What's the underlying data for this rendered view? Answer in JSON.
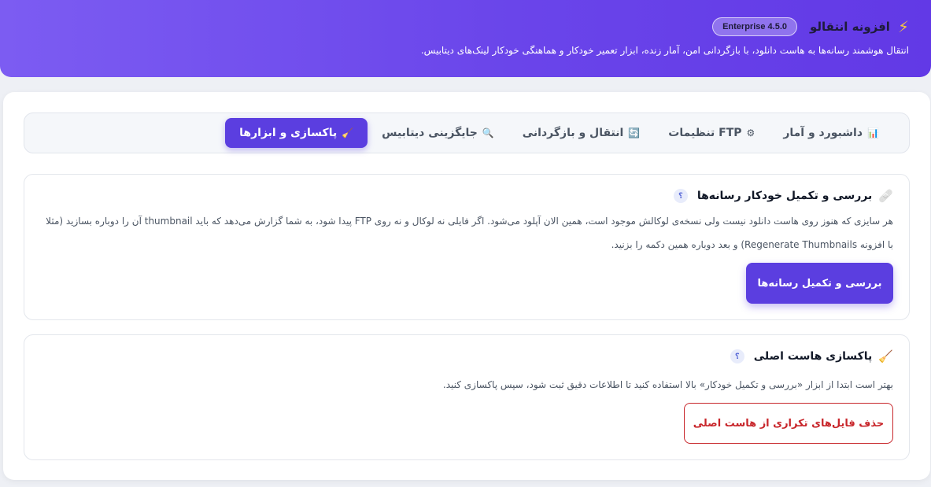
{
  "header": {
    "bolt_icon": "⚡",
    "title": "افزونه انتقالو",
    "version_badge": "Enterprise 4.5.0",
    "subtitle": "انتقال هوشمند رسانه‌ها به هاست دانلود، با بازگردانی امن، آمار زنده، ابزار تعمیر خودکار و هماهنگی خودکار لینک‌های دیتابیس."
  },
  "tabs": [
    {
      "icon": "📊",
      "label": "داشبورد و آمار",
      "active": false
    },
    {
      "icon": "⚙",
      "label": "تنظیمات FTP",
      "active": false
    },
    {
      "icon": "🔄",
      "label": "انتقال و بازگردانی",
      "active": false
    },
    {
      "icon": "🔍",
      "label": "جایگزینی دیتابیس",
      "active": false
    },
    {
      "icon": "🧹",
      "label": "پاکسازی و ابزارها",
      "active": true
    }
  ],
  "card_repair": {
    "icon": "🩹",
    "title": "بررسی و تکمیل خودکار رسانه‌ها",
    "help": "؟",
    "description": "هر سایزی که هنوز روی هاست دانلود نیست ولی نسخه‌ی لوکالش موجود است، همین الان آپلود می‌شود. اگر فایلی نه لوکال و نه روی FTP پیدا شود، به شما گزارش می‌دهد که باید thumbnail آن را دوباره بسازید (مثلا با افزونه Regenerate Thumbnails) و بعد دوباره همین دکمه را بزنید.",
    "button_label": "بررسی و تکمیل رسانه‌ها"
  },
  "card_cleanup": {
    "icon": "🧹",
    "title": "پاکسازی هاست اصلی",
    "help": "؟",
    "description": "بهتر است ابتدا از ابزار «بررسی و تکمیل خودکار» بالا استفاده کنید تا اطلاعات دقیق ثبت شود، سپس پاکسازی کنید.",
    "button_label": "حذف فایل‌های تکراری از هاست اصلی"
  },
  "colors": {
    "accent": "#5b3ee0",
    "danger": "#c8262b",
    "header_gradient_start": "#7c5cf2",
    "header_gradient_end": "#6239e6"
  }
}
